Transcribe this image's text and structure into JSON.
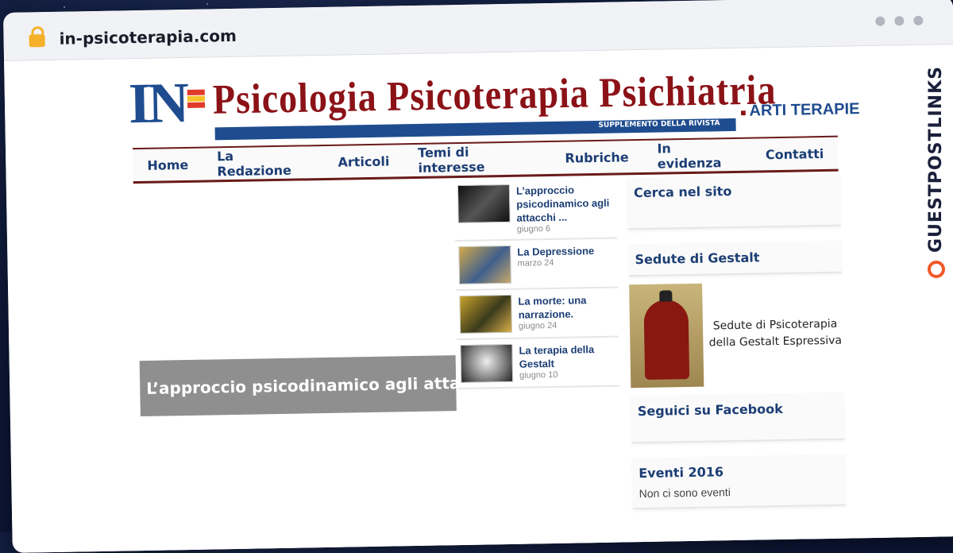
{
  "browser": {
    "url": "in-psicoterapia.com"
  },
  "header": {
    "logo_in": "IN",
    "title": "Psicologia Psicoterapia Psichiatria",
    "supplement": "SUPPLEMENTO DELLA RIVISTA",
    "arti_terapie": "ARTI TERAPIE"
  },
  "nav": {
    "items": [
      "Home",
      "La Redazione",
      "Articoli",
      "Temi di interesse",
      "Rubriche",
      "In evidenza",
      "Contatti"
    ]
  },
  "hero": {
    "caption": "L’approccio psicodinamico agli atta..."
  },
  "news": [
    {
      "title": "L’approccio psicodinamico agli attacchi ...",
      "date": "giugno 6"
    },
    {
      "title": "La Depressione",
      "date": "marzo 24"
    },
    {
      "title": "La morte: una narrazione.",
      "date": "giugno 24"
    },
    {
      "title": "La terapia della Gestalt",
      "date": "giugno 10"
    }
  ],
  "sidebar": {
    "search_title": "Cerca nel sito",
    "gestalt_title": "Sedute di Gestalt",
    "gestalt_text": "Sedute di Psicoterapia della Gestalt Espressiva",
    "facebook_title": "Seguici su Facebook",
    "events_title": "Eventi 2016",
    "events_text": "Non ci sono eventi"
  },
  "watermark": "GUESTPOSTLINKS"
}
